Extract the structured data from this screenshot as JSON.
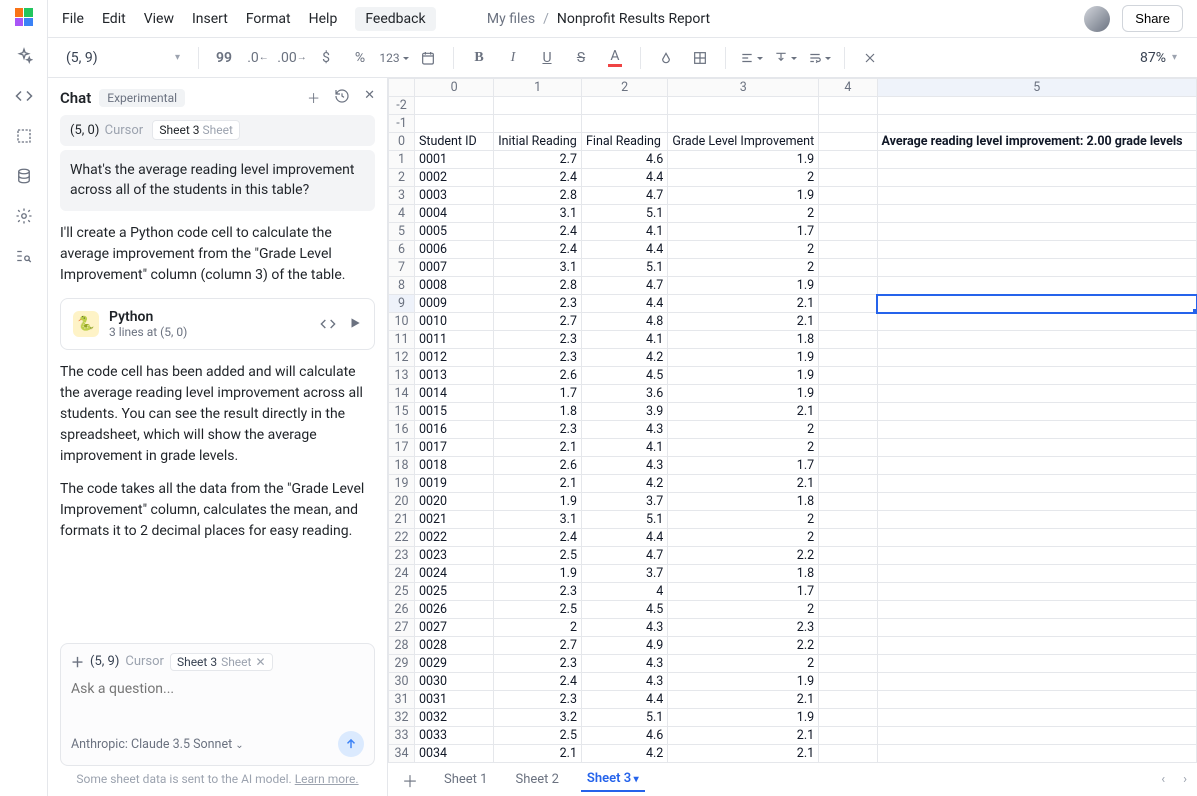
{
  "menubar": {
    "items": [
      "File",
      "Edit",
      "View",
      "Insert",
      "Format",
      "Help"
    ],
    "feedback": "Feedback",
    "breadcrumb_root": "My files",
    "breadcrumb_sep": "/",
    "breadcrumb_title": "Nonprofit Results Report",
    "share": "Share"
  },
  "toolbar": {
    "cell_ref": "(5, 9)",
    "zoom": "87%"
  },
  "chat": {
    "title": "Chat",
    "badge": "Experimental",
    "context1": {
      "loc": "(5, 0)",
      "cursor": "Cursor",
      "sheet_name": "Sheet 3",
      "sheet_type": "Sheet"
    },
    "user_q": "What's the average reading level improvement across all of the students in this table?",
    "ai_1": "I'll create a Python code cell to calculate the average improvement from the \"Grade Level Improvement\" column (column 3) of the table.",
    "code_card": {
      "title": "Python",
      "sub": "3 lines at (5, 0)"
    },
    "ai_2": "The code cell has been added and will calculate the average reading level improvement across all students. You can see the result directly in the spreadsheet, which will show the average improvement in grade levels.",
    "ai_3": "The code takes all the data from the \"Grade Level Improvement\" column, calculates the mean, and formats it to 2 decimal places for easy reading.",
    "input_context": {
      "loc": "(5, 9)",
      "cursor": "Cursor",
      "sheet_name": "Sheet 3",
      "sheet_type": "Sheet"
    },
    "placeholder": "Ask a question...",
    "model_line": "Anthropic: Claude 3.5 Sonnet",
    "disclaimer_a": "Some sheet data is sent to the AI model. ",
    "disclaimer_b": "Learn more."
  },
  "sheet": {
    "col_headers": [
      "0",
      "1",
      "2",
      "3",
      "4",
      "5"
    ],
    "header_row": [
      "Student ID",
      "Initial Reading",
      "Final Reading",
      "Grade Level Improvement",
      "",
      "Average reading level improvement: 2.00 grade levels"
    ],
    "rows": [
      [
        "0001",
        "2.7",
        "4.6",
        "1.9"
      ],
      [
        "0002",
        "2.4",
        "4.4",
        "2"
      ],
      [
        "0003",
        "2.8",
        "4.7",
        "1.9"
      ],
      [
        "0004",
        "3.1",
        "5.1",
        "2"
      ],
      [
        "0005",
        "2.4",
        "4.1",
        "1.7"
      ],
      [
        "0006",
        "2.4",
        "4.4",
        "2"
      ],
      [
        "0007",
        "3.1",
        "5.1",
        "2"
      ],
      [
        "0008",
        "2.8",
        "4.7",
        "1.9"
      ],
      [
        "0009",
        "2.3",
        "4.4",
        "2.1"
      ],
      [
        "0010",
        "2.7",
        "4.8",
        "2.1"
      ],
      [
        "0011",
        "2.3",
        "4.1",
        "1.8"
      ],
      [
        "0012",
        "2.3",
        "4.2",
        "1.9"
      ],
      [
        "0013",
        "2.6",
        "4.5",
        "1.9"
      ],
      [
        "0014",
        "1.7",
        "3.6",
        "1.9"
      ],
      [
        "0015",
        "1.8",
        "3.9",
        "2.1"
      ],
      [
        "0016",
        "2.3",
        "4.3",
        "2"
      ],
      [
        "0017",
        "2.1",
        "4.1",
        "2"
      ],
      [
        "0018",
        "2.6",
        "4.3",
        "1.7"
      ],
      [
        "0019",
        "2.1",
        "4.2",
        "2.1"
      ],
      [
        "0020",
        "1.9",
        "3.7",
        "1.8"
      ],
      [
        "0021",
        "3.1",
        "5.1",
        "2"
      ],
      [
        "0022",
        "2.4",
        "4.4",
        "2"
      ],
      [
        "0023",
        "2.5",
        "4.7",
        "2.2"
      ],
      [
        "0024",
        "1.9",
        "3.7",
        "1.8"
      ],
      [
        "0025",
        "2.3",
        "4",
        "1.7"
      ],
      [
        "0026",
        "2.5",
        "4.5",
        "2"
      ],
      [
        "0027",
        "2",
        "4.3",
        "2.3"
      ],
      [
        "0028",
        "2.7",
        "4.9",
        "2.2"
      ],
      [
        "0029",
        "2.3",
        "4.3",
        "2"
      ],
      [
        "0030",
        "2.4",
        "4.3",
        "1.9"
      ],
      [
        "0031",
        "2.3",
        "4.4",
        "2.1"
      ],
      [
        "0032",
        "3.2",
        "5.1",
        "1.9"
      ],
      [
        "0033",
        "2.5",
        "4.6",
        "2.1"
      ],
      [
        "0034",
        "2.1",
        "4.2",
        "2.1"
      ]
    ],
    "selected": {
      "row": 9,
      "col": 5
    },
    "tabs": [
      "Sheet 1",
      "Sheet 2",
      "Sheet 3"
    ],
    "active_tab": 2
  }
}
